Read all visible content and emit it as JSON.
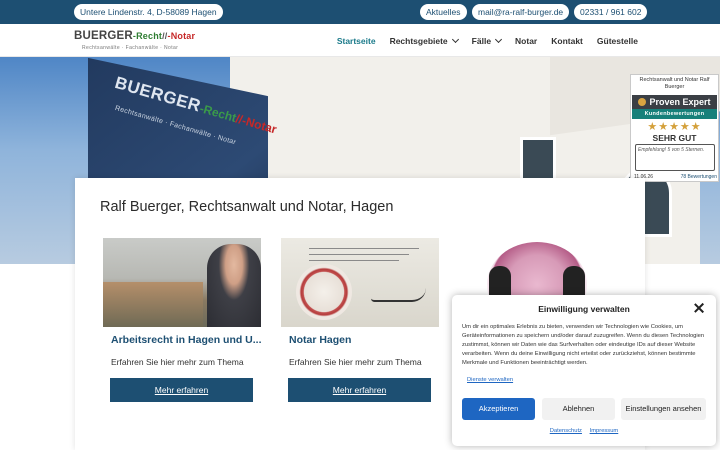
{
  "topbar": {
    "address": "Untere Lindenstr. 4, D-58089 Hagen",
    "news": "Aktuelles",
    "email": "mail@ra-ralf-burger.de",
    "phone": "02331 / 961 602"
  },
  "logo": {
    "name": "BUERGER",
    "recht": "-Recht",
    "separator": "//",
    "notar": "-Notar",
    "tagline": "Rechtsanwälte · Fachanwälte · Notar"
  },
  "nav": {
    "items": [
      {
        "label": "Startseite"
      },
      {
        "label": "Rechtsgebiete"
      },
      {
        "label": "Fälle"
      },
      {
        "label": "Notar"
      },
      {
        "label": "Kontakt"
      },
      {
        "label": "Gütestelle"
      }
    ]
  },
  "hero": {
    "sign_name": "BUERGER",
    "sign_recht": "-Recht",
    "sign_notar": "//-Notar",
    "sign_sub": "Rechtsanwälte · Fachanwälte · Notar"
  },
  "proven_expert": {
    "title": "Rechtsanwalt und Notar Ralf Buerger",
    "brand": "Proven Expert",
    "kunden": "Kundenbewertungen",
    "stars": "★★★★★",
    "grade": "SEHR GUT",
    "quote": "Empfehlung! 5 von 5 Sternen.",
    "date": "11.06.26",
    "reviews": "78 Bewertungen"
  },
  "main": {
    "title": "Ralf Buerger, Rechtsanwalt und Notar, Hagen",
    "tiles": [
      {
        "heading": "Arbeitsrecht in Hagen und U...",
        "text": "Erfahren Sie hier mehr zum Thema",
        "button": "Mehr erfahren"
      },
      {
        "heading": "Notar Hagen",
        "text": "Erfahren Sie hier mehr zum Thema",
        "button": "Mehr erfahren"
      }
    ]
  },
  "cookie": {
    "title": "Einwilligung verwalten",
    "text": "Um dir ein optimales Erlebnis zu bieten, verwenden wir Technologien wie Cookies, um Geräteinformationen zu speichern und/oder darauf zuzugreifen. Wenn du diesen Technologien zustimmst, können wir Daten wie das Surfverhalten oder eindeutige IDs auf dieser Website verarbeiten. Wenn du deine Einwilligung nicht erteilst oder zurückziehst, können bestimmte Merkmale und Funktionen beeinträchtigt werden.",
    "services_link": "Dienste verwalten",
    "accept": "Akzeptieren",
    "deny": "Ablehnen",
    "prefs": "Einstellungen ansehen",
    "privacy": "Datenschutz",
    "imprint": "Impressum"
  },
  "colors": {
    "brand_blue": "#1d4f72",
    "accent_teal": "#1a7a8a",
    "cookie_blue": "#1e66c2"
  }
}
